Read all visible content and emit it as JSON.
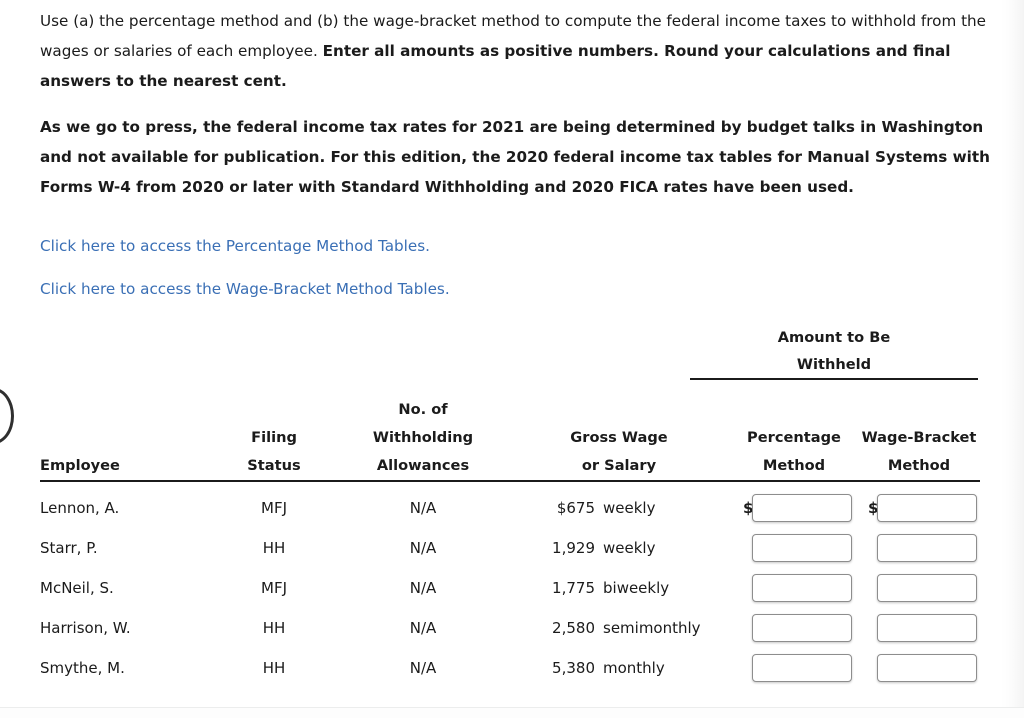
{
  "instructions": {
    "intro_lead": "Use (a) the percentage method and (b) the wage-bracket method to compute the federal income taxes to withhold from the wages or salaries of each employee. ",
    "intro_strong": "Enter all amounts as positive numbers. Round your calculations and final answers to the nearest cent.",
    "note": "As we go to press, the federal income tax rates for 2021 are being determined by budget talks in Washington and not available for publication. For this edition, the 2020 federal income tax tables for Manual Systems with Forms W-4 from 2020 or later with Standard Withholding and 2020 FICA rates have been used."
  },
  "links": {
    "percentage_tables": "Click here to access the Percentage Method Tables.",
    "wage_bracket_tables": "Click here to access the Wage-Bracket Method Tables."
  },
  "table": {
    "group_header": {
      "line1": "Amount to Be",
      "line2": "Withheld"
    },
    "headers": {
      "employee": "Employee",
      "filing_status_line1": "Filing",
      "filing_status_line2": "Status",
      "allowances_line1": "No. of",
      "allowances_line2": "Withholding",
      "allowances_line3": "Allowances",
      "wage_line1": "Gross Wage",
      "wage_line2": "or Salary",
      "percentage_line1": "Percentage",
      "percentage_line2": "Method",
      "bracket_line1": "Wage-Bracket",
      "bracket_line2": "Method"
    },
    "currency_symbol": "$",
    "input_placeholder": "",
    "rows": [
      {
        "employee": "Lennon, A.",
        "filing_status": "MFJ",
        "allowances": "N/A",
        "wage_amount": "$675",
        "wage_period": "weekly",
        "percentage_value": "",
        "bracket_value": "",
        "show_dollar": true
      },
      {
        "employee": "Starr, P.",
        "filing_status": "HH",
        "allowances": "N/A",
        "wage_amount": "1,929",
        "wage_period": "weekly",
        "percentage_value": "",
        "bracket_value": "",
        "show_dollar": false
      },
      {
        "employee": "McNeil, S.",
        "filing_status": "MFJ",
        "allowances": "N/A",
        "wage_amount": "1,775",
        "wage_period": "biweekly",
        "percentage_value": "",
        "bracket_value": "",
        "show_dollar": false
      },
      {
        "employee": "Harrison, W.",
        "filing_status": "HH",
        "allowances": "N/A",
        "wage_amount": "2,580",
        "wage_period": "semimonthly",
        "percentage_value": "",
        "bracket_value": "",
        "show_dollar": false
      },
      {
        "employee": "Smythe, M.",
        "filing_status": "HH",
        "allowances": "N/A",
        "wage_amount": "5,380",
        "wage_period": "monthly",
        "percentage_value": "",
        "bracket_value": "",
        "show_dollar": false
      }
    ]
  },
  "colors": {
    "link": "#3a6fb5",
    "text": "#1b1b1b",
    "rule": "#1b1b1b",
    "input_border": "#8d8d8d",
    "background": "#ffffff"
  }
}
